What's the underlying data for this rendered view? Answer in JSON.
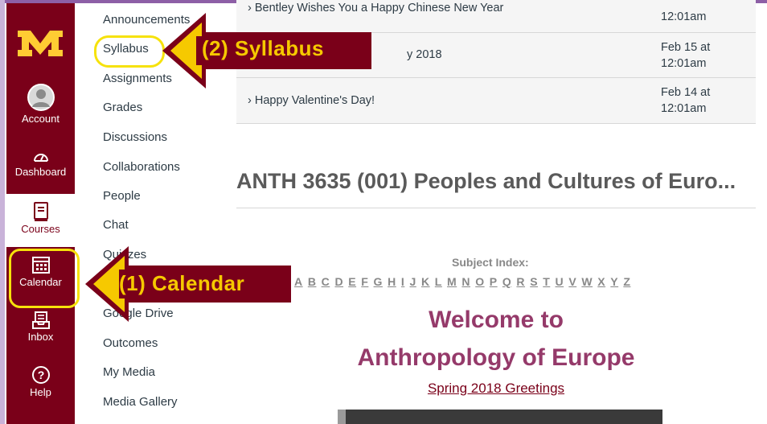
{
  "global_nav": {
    "account": "Account",
    "dashboard": "Dashboard",
    "courses": "Courses",
    "calendar": "Calendar",
    "inbox": "Inbox",
    "help": "Help"
  },
  "course_nav": {
    "items": [
      "Announcements",
      "Syllabus",
      "Assignments",
      "Grades",
      "Discussions",
      "Collaborations",
      "People",
      "Chat",
      "Quizzes",
      "Google Drive",
      "Outcomes",
      "My Media",
      "Media Gallery"
    ]
  },
  "announcements": [
    {
      "title": "Bentley Wishes You a Happy Chinese New Year",
      "date": "12:01am"
    },
    {
      "title": "y 2018",
      "date_line1": "Feb 15 at",
      "date_line2": "12:01am"
    },
    {
      "title": "Happy Valentine's Day!",
      "date_line1": "Feb 14 at",
      "date_line2": "12:01am"
    }
  ],
  "course_title": "ANTH 3635 (001) Peoples and Cultures of Euro...",
  "subject_index": {
    "label": "Subject Index:",
    "letters": [
      "A",
      "B",
      "C",
      "D",
      "E",
      "F",
      "G",
      "H",
      "I",
      "J",
      "K",
      "L",
      "M",
      "N",
      "O",
      "P",
      "Q",
      "R",
      "S",
      "T",
      "U",
      "V",
      "W",
      "X",
      "Y",
      "Z"
    ]
  },
  "welcome": {
    "line1": "Welcome to",
    "line2": "Anthropology of Europe",
    "link": "Spring 2018 Greetings"
  },
  "annotations": {
    "syllabus": "(2) Syllabus",
    "calendar": "(1) Calendar"
  },
  "colors": {
    "nav_bg": "#7a0019",
    "highlight": "#f6e20b",
    "arrow_fill": "#f6c900",
    "callout_bg": "#7a0019",
    "welcome": "#953a6a"
  }
}
